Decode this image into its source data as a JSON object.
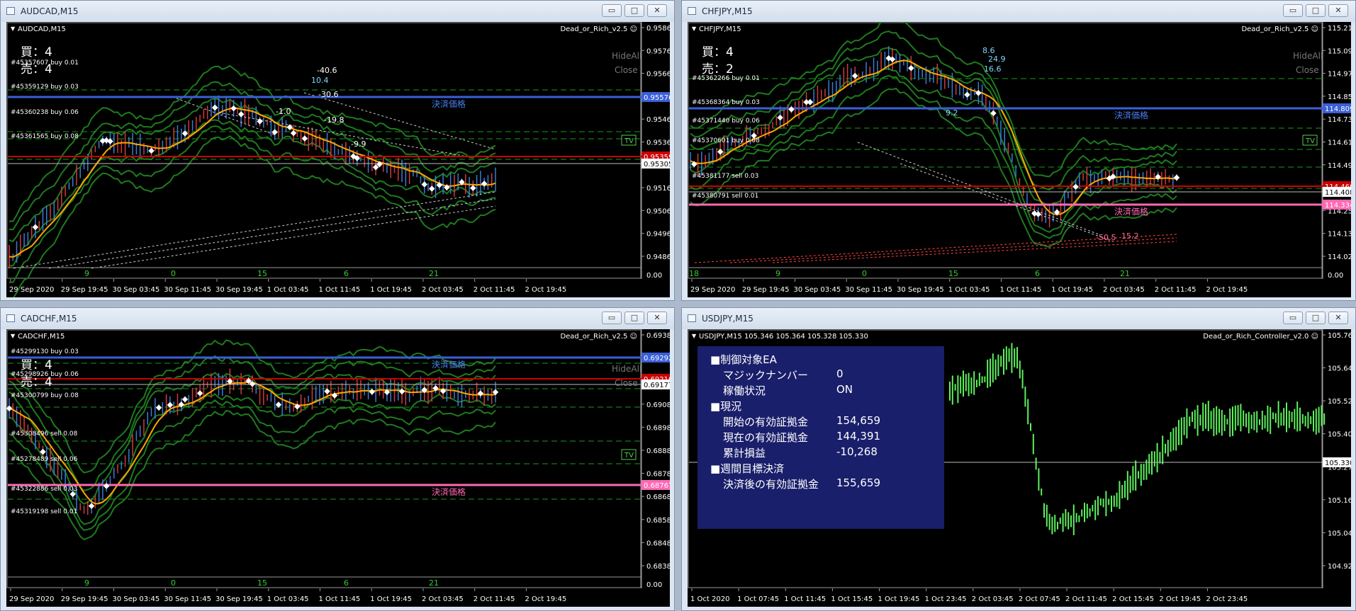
{
  "charts": {
    "audcad": {
      "window_title": "AUDCAD,M15",
      "symbol_label": "AUDCAD,M15",
      "ea_label": "Dead_or_Rich_v2.5",
      "buy_count": "買：4",
      "sell_count": "売：4",
      "hide_all": "HideAll",
      "close": "Close",
      "tv": "TV",
      "settle_label": "決済価格",
      "orders": [
        "#45357607 buy 0.01",
        "#45359129 buy 0.03",
        "#45360238 buy 0.06",
        "#45361565 buy 0.08"
      ],
      "diffs": [
        "-40.6",
        "10.4",
        "-30.6",
        "-19.8",
        "-9.9",
        "-1.0"
      ],
      "prices": [
        "0.95860",
        "0.95760",
        "0.95660",
        "0.95560",
        "0.95460",
        "0.95360",
        "0.95260",
        "0.95160",
        "0.95060",
        "0.94960",
        "0.94860"
      ],
      "settle_price": "0.95576",
      "red_price": "0.95359",
      "current_price": "0.95305",
      "zero_label": "0.00",
      "hour_ticks": [
        "9",
        "0",
        "15",
        "6",
        "21"
      ],
      "time_labels": [
        "29 Sep 2020",
        "29 Sep 19:45",
        "30 Sep 03:45",
        "30 Sep 11:45",
        "30 Sep 19:45",
        "1 Oct 03:45",
        "1 Oct 11:45",
        "1 Oct 19:45",
        "2 Oct 03:45",
        "2 Oct 11:45",
        "2 Oct 19:45"
      ]
    },
    "chfjpy": {
      "window_title": "CHFJPY,M15",
      "symbol_label": "CHFJPY,M15",
      "ea_label": "Dead_or_Rich_v2.5",
      "buy_count": "買：4",
      "sell_count": "売：2",
      "hide_all": "HideAll",
      "close": "Close",
      "tv": "TV",
      "settle_label": "決済価格",
      "settle_label_2": "決済価格",
      "orders": [
        "#45362266 buy 0.01",
        "#45368364 buy 0.03",
        "#45371440 buy 0.06",
        "#45370601 buy 0.08",
        "#45381177 sell 0.03",
        "#45380791 sell 0.01"
      ],
      "diffs": [
        "8.6",
        "24.9",
        "16.6",
        "9.2",
        "-50.5",
        "15.2"
      ],
      "prices": [
        "115.210",
        "115.090",
        "114.970",
        "114.850",
        "114.730",
        "114.610",
        "114.490",
        "114.370",
        "114.250",
        "114.130",
        "114.020"
      ],
      "settle_price": "114.809",
      "red_price": "114.460",
      "current_price": "114.408",
      "settle_price_2": "114.334",
      "zero_label": "0.00",
      "hour_ticks": [
        "18",
        "9",
        "0",
        "15",
        "6",
        "21"
      ],
      "time_labels": [
        "29 Sep 2020",
        "29 Sep 19:45",
        "30 Sep 03:45",
        "30 Sep 11:45",
        "30 Sep 19:45",
        "1 Oct 03:45",
        "1 Oct 11:45",
        "1 Oct 19:45",
        "2 Oct 03:45",
        "2 Oct 11:45",
        "2 Oct 19:45"
      ]
    },
    "cadchf": {
      "window_title": "CADCHF,M15",
      "symbol_label": "CADCHF,M15",
      "ea_label": "Dead_or_Rich_v2.5",
      "buy_count": "買：4",
      "sell_count": "売：4",
      "hide_all": "HideAll",
      "close": "Close",
      "tv": "TV",
      "settle_label": "決済価格",
      "settle_label_2": "決済価格",
      "orders": [
        "#45299130 buy 0.03",
        "#45298926 buy 0.06",
        "#45300799 buy 0.08",
        "#45308496 sell 0.08",
        "#45278489 sell 0.06",
        "#45322886 sell 0.03",
        "#45319198 sell 0.01"
      ],
      "prices": [
        "0.69380",
        "0.69290",
        "0.69180",
        "0.69080",
        "0.68980",
        "0.68880",
        "0.68780",
        "0.68680",
        "0.68580",
        "0.68480",
        "0.68380"
      ],
      "settle_price": "0.69292",
      "red_price": "0.69210",
      "current_price": "0.69177",
      "settle_price_2": "0.68767",
      "zero_label": "0.00",
      "hour_ticks": [
        "9",
        "0",
        "15",
        "6",
        "21"
      ],
      "time_labels": [
        "29 Sep 2020",
        "29 Sep 19:45",
        "30 Sep 03:45",
        "30 Sep 11:45",
        "30 Sep 19:45",
        "1 Oct 03:45",
        "1 Oct 11:45",
        "1 Oct 19:45",
        "2 Oct 03:45",
        "2 Oct 11:45",
        "2 Oct 19:45"
      ]
    },
    "usdjpy": {
      "window_title": "USDJPY,M15",
      "symbol_label": "USDJPY,M15  105.346 105.364 105.328 105.330",
      "ea_label": "Dead_or_Rich_Controller_v2.0",
      "prices": [
        "105.760",
        "105.640",
        "105.520",
        "105.400",
        "105.275",
        "105.165",
        "105.045",
        "104.925"
      ],
      "current_price": "105.330",
      "time_labels": [
        "1 Oct 2020",
        "1 Oct 07:45",
        "1 Oct 11:45",
        "1 Oct 15:45",
        "1 Oct 19:45",
        "1 Oct 23:45",
        "2 Oct 03:45",
        "2 Oct 07:45",
        "2 Oct 11:45",
        "2 Oct 15:45",
        "2 Oct 19:45",
        "2 Oct 23:45"
      ],
      "panel": {
        "section1": "■制御対象EA",
        "magic_label": "マジックナンバー",
        "magic_value": "0",
        "status_label": "稼働状況",
        "status_value": "ON",
        "section2": "■現況",
        "start_equity_label": "開始の有効証拠金",
        "start_equity_value": "154,659",
        "current_equity_label": "現在の有効証拠金",
        "current_equity_value": "144,391",
        "pnl_label": "累計損益",
        "pnl_value": "-10,268",
        "section3": "■週間目標決済",
        "after_equity_label": "決済後の有効証拠金",
        "after_equity_value": "155,659"
      }
    }
  },
  "window_buttons": {
    "minimize": "▭",
    "maximize": "□",
    "close": "✕"
  },
  "colors": {
    "bg": "#000000",
    "band": "#1f7a1f",
    "ma": "#ffa500",
    "settle": "#3a5fd8",
    "settle2": "#ff69b4",
    "current": "#cc0000",
    "price_box": "#3a5fd8"
  }
}
